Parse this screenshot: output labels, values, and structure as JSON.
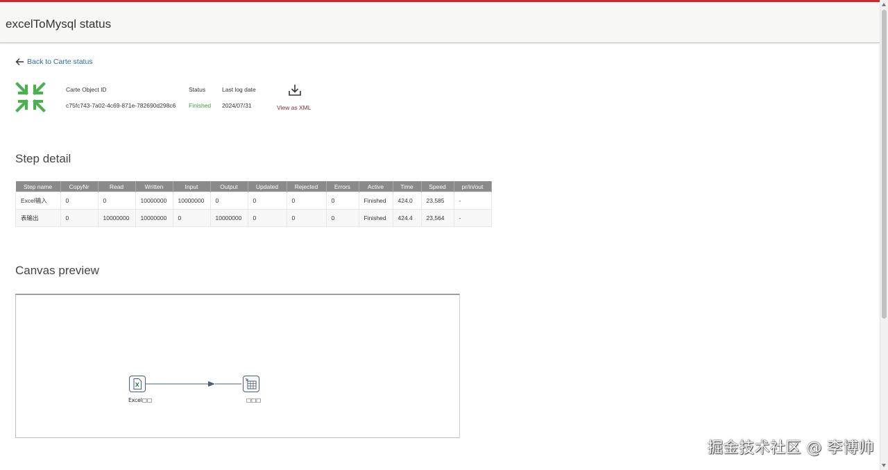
{
  "header": {
    "title": "excelToMysql status"
  },
  "back_link": {
    "label": "Back to Carte status"
  },
  "status_info": {
    "object_id_label": "Carte Object ID",
    "object_id_value": "c75fc743-7a02-4c69-871e-782690d298c6",
    "status_label": "Status",
    "status_value": "Finished",
    "last_log_label": "Last log date",
    "last_log_value": "2024/07/31",
    "view_xml_label": "View as XML"
  },
  "step_detail": {
    "title": "Step detail",
    "columns": [
      "Step name",
      "CopyNr",
      "Read",
      "Written",
      "Input",
      "Output",
      "Updated",
      "Rejected",
      "Errors",
      "Active",
      "Time",
      "Speed",
      "pr/in/out"
    ],
    "rows": [
      [
        "Excel输入",
        "0",
        "0",
        "10000000",
        "10000000",
        "0",
        "0",
        "0",
        "0",
        "Finished",
        "424.0",
        "23,585",
        "-"
      ],
      [
        "表输出",
        "0",
        "10000000",
        "10000000",
        "0",
        "10000000",
        "0",
        "0",
        "0",
        "Finished",
        "424.4",
        "23,564",
        "-"
      ]
    ]
  },
  "canvas_preview": {
    "title": "Canvas preview",
    "nodes": [
      {
        "label": "Excel□□",
        "icon": "excel-input-icon"
      },
      {
        "label": "□□□",
        "icon": "table-output-icon"
      }
    ]
  },
  "watermark": "掘金技术社区 @ 李博帅",
  "colors": {
    "accent": "#cc2a2a",
    "status_ok": "#3e9b3e",
    "link": "#2f6aa8",
    "xml_link": "#8b2b2b",
    "icon_green": "#4caf50"
  }
}
